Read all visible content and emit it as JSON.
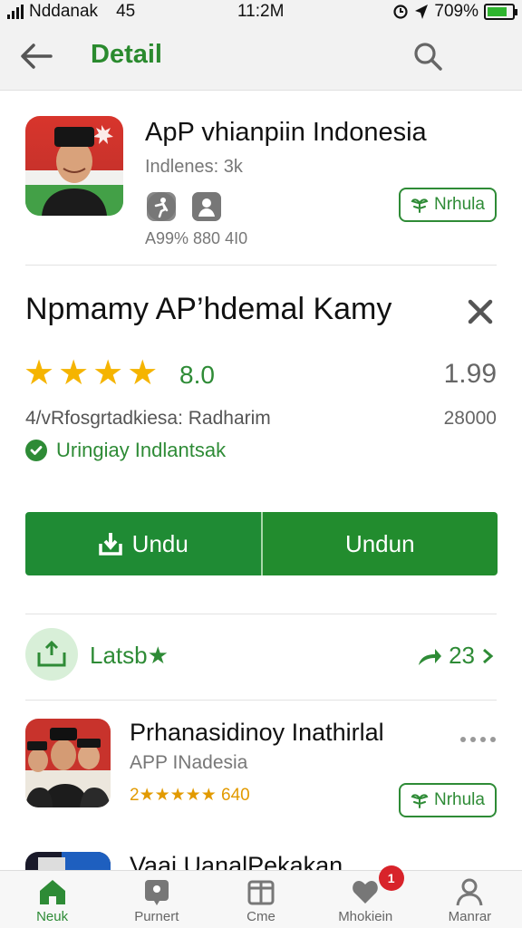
{
  "status_bar": {
    "carrier": "Nddanak",
    "network": "45",
    "time": "11:2M",
    "battery": "709%"
  },
  "header": {
    "title": "Detail"
  },
  "app": {
    "name": "ApP vhianpiin Indonesia",
    "subtitle": "Indlenes: 3k",
    "meta": "A99% 880 4I0",
    "action_label": "Nrhula"
  },
  "info": {
    "title": "Npmamy AP’hdemal Kamy",
    "rating": "8.0",
    "stars": 4,
    "price": "1.99",
    "description": "4/vRfosgrtadkiesa: Radharim",
    "count": "28000",
    "verified_label": "Uringiay Indlantsak"
  },
  "buttons": {
    "primary_label": "Undu",
    "secondary_label": "Undun"
  },
  "latest": {
    "label": "Latsb★",
    "count": "23"
  },
  "list_item": {
    "title": "Prhanasidinoy Inathirlal",
    "subtitle": "APP INadesia",
    "rating_text": "2★★★★★ 640",
    "action_label": "Nrhula"
  },
  "partial_item": {
    "title": "Vaai UanalPekakan"
  },
  "bottom_nav": {
    "items": [
      {
        "label": "Neuk",
        "icon": "home-icon",
        "active": true
      },
      {
        "label": "Purnert",
        "icon": "map-pin-icon",
        "active": false
      },
      {
        "label": "Cme",
        "icon": "box-icon",
        "active": false
      },
      {
        "label": "Mhokiein",
        "icon": "heart-icon",
        "active": false,
        "badge": "1"
      },
      {
        "label": "Manrar",
        "icon": "person-icon",
        "active": false
      }
    ]
  },
  "colors": {
    "accent": "#2e8b36",
    "button": "#1f8b34",
    "star": "#f5b400",
    "badge": "#d8232a"
  }
}
